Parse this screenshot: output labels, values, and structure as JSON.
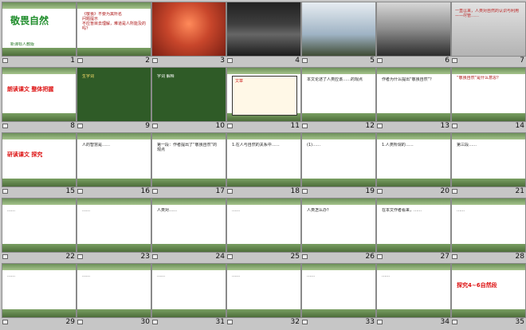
{
  "slides": [
    {
      "n": "1",
      "title": "敬畏自然",
      "sub": "新课标人教版"
    },
    {
      "n": "2",
      "text": "《敬畏》不要为其所名\n问题提示\n不应盲目去理解，难道是人所能及的吗？"
    },
    {
      "n": "3"
    },
    {
      "n": "4"
    },
    {
      "n": "5"
    },
    {
      "n": "6"
    },
    {
      "n": "7",
      "text": "一直以来，人类对自然的认识与利用\n——尽管……"
    },
    {
      "n": "8",
      "title": "朗读课文 整体把握"
    },
    {
      "n": "9",
      "text": "生字词"
    },
    {
      "n": "10",
      "text": "字词 解释"
    },
    {
      "n": "11",
      "text": "文章"
    },
    {
      "n": "12",
      "text": "本文论述了人类应该……的观点"
    },
    {
      "n": "13",
      "text": "作者为什么提出“敬畏自然”？"
    },
    {
      "n": "14",
      "text": "“敬畏自然”是什么意思？"
    },
    {
      "n": "15",
      "title": "研读课文 探究"
    },
    {
      "n": "16",
      "text": "人的智慧是……"
    },
    {
      "n": "17",
      "text": "第一段：作者提出了“敬畏自然”的观点"
    },
    {
      "n": "18",
      "text": "1.在人与自然的关系中……"
    },
    {
      "n": "19",
      "text": "(1)……"
    },
    {
      "n": "20",
      "text": "1.人类所谓的……"
    },
    {
      "n": "21",
      "text": "第三段……"
    },
    {
      "n": "22",
      "text": "……"
    },
    {
      "n": "23",
      "text": "……"
    },
    {
      "n": "24",
      "text": "人类对……"
    },
    {
      "n": "25",
      "text": "……"
    },
    {
      "n": "26",
      "text": "人类怎么办？"
    },
    {
      "n": "27",
      "text": "在本文作者看来，……"
    },
    {
      "n": "28",
      "text": "……"
    },
    {
      "n": "29",
      "text": "……"
    },
    {
      "n": "30",
      "text": "……"
    },
    {
      "n": "31",
      "text": "……"
    },
    {
      "n": "32",
      "text": "……"
    },
    {
      "n": "33",
      "text": "……"
    },
    {
      "n": "34",
      "text": "……"
    },
    {
      "n": "35",
      "title": "探究4~6自然段"
    }
  ]
}
